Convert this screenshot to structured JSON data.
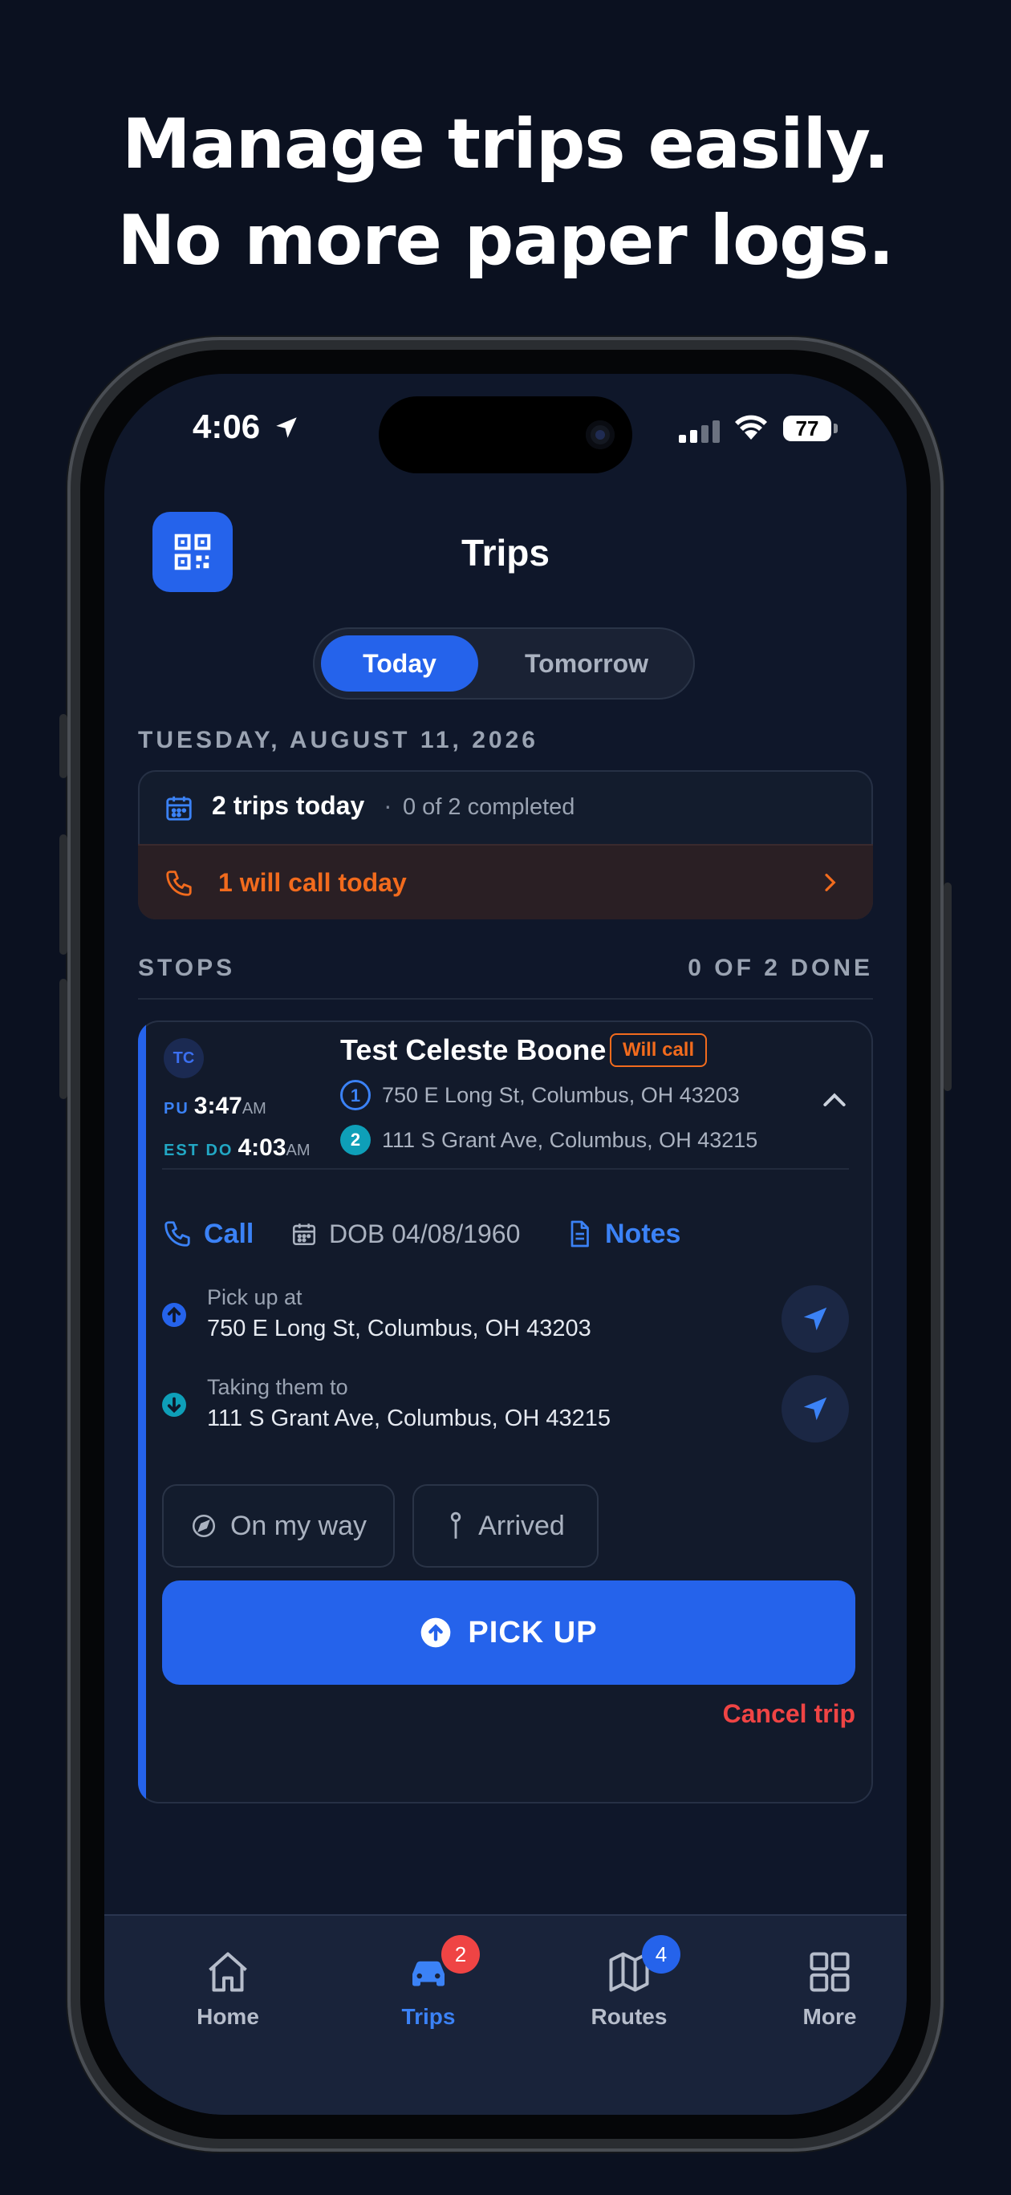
{
  "headline": {
    "line1": "Manage trips easily.",
    "line2": "No more paper logs."
  },
  "status_bar": {
    "time": "4:06",
    "battery": "77"
  },
  "header": {
    "title": "Trips",
    "qr_icon": "qr-code-icon"
  },
  "day_toggle": {
    "options": [
      "Today",
      "Tomorrow"
    ],
    "selected": "Today"
  },
  "date_label": "TUESDAY, AUGUST 11, 2026",
  "summary": {
    "trips_count": "2 trips today",
    "separator": "·",
    "completed": "0 of 2 completed",
    "will_call": "1 will call today"
  },
  "stops": {
    "label": "STOPS",
    "done": "0 OF 2 DONE"
  },
  "trip": {
    "initials": "TC",
    "pu_label": "PU",
    "pu_time": "3:47",
    "pu_ampm": "AM",
    "do_label": "EST DO",
    "do_time": "4:03",
    "do_ampm": "AM",
    "rider": "Test Celeste Boone",
    "badge": "Will call",
    "stop1_num": "1",
    "stop1": "750 E Long St, Columbus, OH 43203",
    "stop2_num": "2",
    "stop2": "111 S Grant Ave, Columbus, OH 43215",
    "call_label": "Call",
    "dob_label": "DOB 04/08/1960",
    "notes_label": "Notes",
    "pickup_caption": "Pick up at",
    "pickup_address": "750 E Long St, Columbus, OH 43203",
    "dropoff_caption": "Taking them to",
    "dropoff_address": "111 S Grant Ave, Columbus, OH 43215",
    "on_my_way": "On my way",
    "arrived": "Arrived",
    "pickup_button": "PICK UP",
    "cancel": "Cancel trip"
  },
  "tabbar": {
    "items": [
      {
        "label": "Home",
        "icon": "home-icon"
      },
      {
        "label": "Trips",
        "icon": "car-icon",
        "badge": "2"
      },
      {
        "label": "Routes",
        "icon": "map-icon",
        "badge": "4"
      },
      {
        "label": "More",
        "icon": "grid-icon"
      }
    ],
    "active": "Trips"
  },
  "colors": {
    "accent": "#2563eb",
    "warning": "#f26b1d",
    "danger": "#ef4444",
    "teal": "#0e9fb8",
    "background": "#0b1120"
  }
}
